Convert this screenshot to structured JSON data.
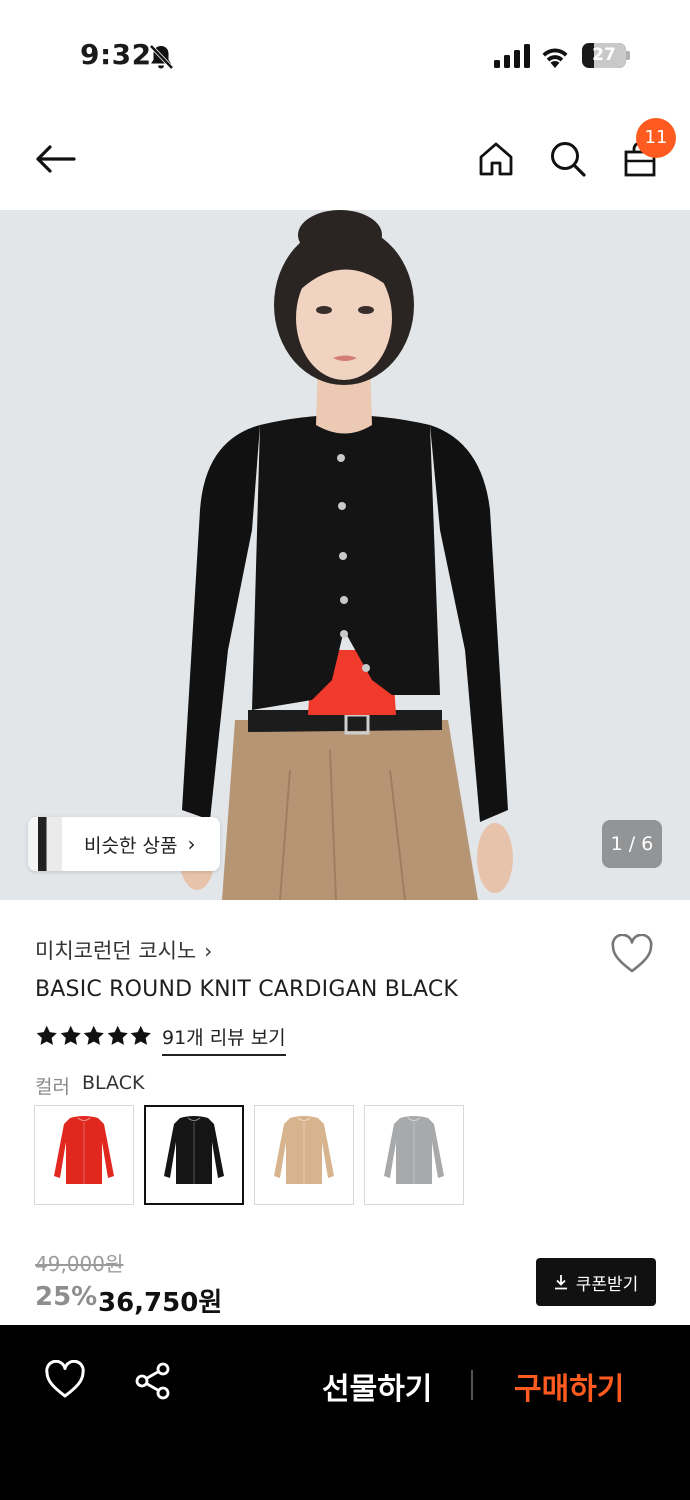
{
  "status_bar": {
    "time": "9:32",
    "battery": "27",
    "battery_level": 0.27
  },
  "nav": {
    "cart_count": "11"
  },
  "hero": {
    "similar_label": "비슷한 상품",
    "page_indicator": "1 / 6"
  },
  "product": {
    "brand": "미치코런던 코시노",
    "title": "BASIC ROUND KNIT CARDIGAN BLACK",
    "rating_stars": 5,
    "review_link": "91개 리뷰 보기",
    "color_label": "컬러",
    "color_value": "BLACK",
    "swatches": [
      {
        "name": "red",
        "color": "#e0281f"
      },
      {
        "name": "black",
        "color": "#151515",
        "selected": true
      },
      {
        "name": "beige",
        "color": "#d8b48e"
      },
      {
        "name": "gray",
        "color": "#a8a9ab"
      }
    ]
  },
  "price": {
    "original": "49,000원",
    "discount": "25%",
    "sale": "36,750원",
    "coupon_label": "쿠폰받기"
  },
  "bottom_bar": {
    "gift_label": "선물하기",
    "buy_label": "구매하기"
  },
  "colors": {
    "accent": "#ff5a1f",
    "bar": "#000000"
  }
}
